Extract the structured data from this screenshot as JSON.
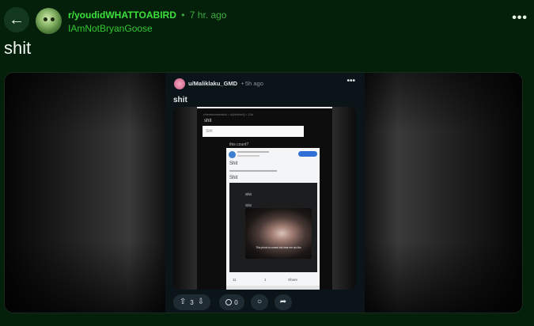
{
  "header": {
    "back_icon": "arrow-left-icon",
    "subreddit": "r/youdidWHATTOABIRD",
    "separator": "•",
    "time_ago": "7 hr. ago",
    "author": "IAmNotBryanGoose",
    "more_icon": "more-horizontal-icon",
    "more_label": "•••"
  },
  "post": {
    "title": "shit"
  },
  "embedded_post": {
    "username": "u/Maliklaku_GMD",
    "time_ago": "5h ago",
    "separator": "•",
    "more_label": "•••",
    "title": "shit",
    "screenshot": {
      "meta_top": "r/bestnurseestick • u/[deleted] • 13d",
      "label": "shit",
      "input_value": "Shit",
      "question": "this count?",
      "panel_title_1": "Shit",
      "panel_title_2": "Shit",
      "dark_label_1": "Shit",
      "dark_label_2": "Shit",
      "caption": "This photo is cursed but hear me out tho",
      "action_1": "11",
      "action_2": "1",
      "action_3": "Share"
    },
    "actions": {
      "vote_count": "3",
      "comment_count": "0",
      "upvote_icon": "upvote-arrow-icon",
      "downvote_icon": "downvote-arrow-icon",
      "comment_icon": "comment-bubble-icon",
      "award_icon": "award-icon",
      "share_icon": "share-arrow-icon"
    }
  },
  "colors": {
    "background": "#04200a",
    "subreddit": "#3be23b",
    "author": "#32c732"
  }
}
